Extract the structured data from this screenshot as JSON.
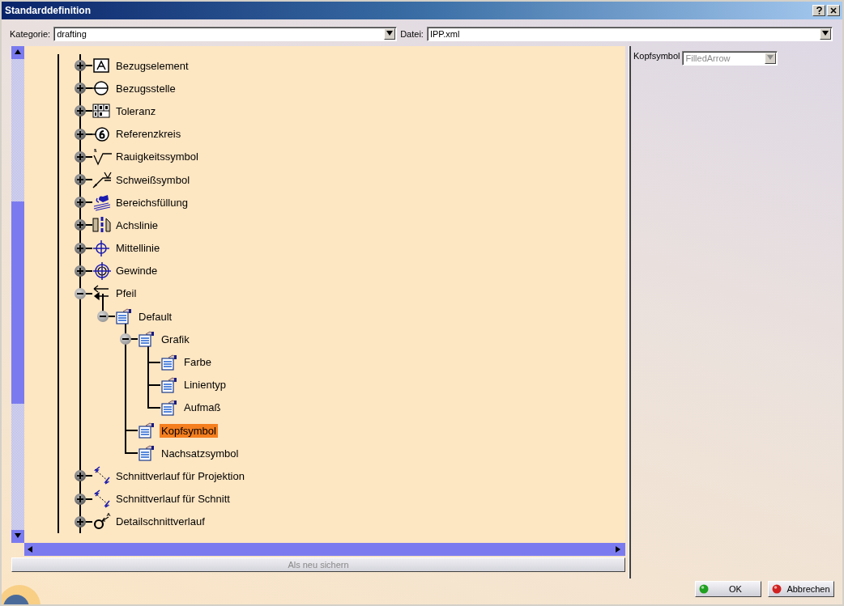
{
  "window": {
    "title": "Standarddefinition"
  },
  "toolbar": {
    "category": {
      "label": "Kategorie:",
      "value": "drafting"
    },
    "file": {
      "label": "Datei:",
      "value": "IPP.xml"
    }
  },
  "tree": {
    "items": [
      {
        "label": "Bezugselement",
        "kind": "datum",
        "expanded": false,
        "selected": false
      },
      {
        "label": "Bezugsstelle",
        "kind": "datum-target",
        "expanded": false,
        "selected": false
      },
      {
        "label": "Toleranz",
        "kind": "tolerance",
        "expanded": false,
        "selected": false
      },
      {
        "label": "Referenzkreis",
        "kind": "reference",
        "expanded": false,
        "selected": false
      },
      {
        "label": "Rauigkeitssymbol",
        "kind": "roughness",
        "expanded": false,
        "selected": false
      },
      {
        "label": "Schweißsymbol",
        "kind": "weld",
        "expanded": false,
        "selected": false
      },
      {
        "label": "Bereichsfüllung",
        "kind": "hatch",
        "expanded": false,
        "selected": false
      },
      {
        "label": "Achslinie",
        "kind": "axis",
        "expanded": false,
        "selected": false
      },
      {
        "label": "Mittellinie",
        "kind": "centerline",
        "expanded": false,
        "selected": false
      },
      {
        "label": "Gewinde",
        "kind": "thread",
        "expanded": false,
        "selected": false
      },
      {
        "label": "Pfeil",
        "kind": "arrow",
        "expanded": true,
        "selected": false,
        "children": [
          {
            "label": "Default",
            "kind": "settings",
            "expanded": true,
            "selected": false,
            "children": [
              {
                "label": "Grafik",
                "kind": "settings",
                "expanded": true,
                "selected": false,
                "children": [
                  {
                    "label": "Farbe",
                    "kind": "settings",
                    "selected": false
                  },
                  {
                    "label": "Linientyp",
                    "kind": "settings",
                    "selected": false
                  },
                  {
                    "label": "Aufmaß",
                    "kind": "settings",
                    "selected": false
                  }
                ]
              },
              {
                "label": "Kopfsymbol",
                "kind": "settings",
                "selected": true
              },
              {
                "label": "Nachsatzsymbol",
                "kind": "settings",
                "selected": false
              }
            ]
          }
        ]
      },
      {
        "label": "Schnittverlauf für Projektion",
        "kind": "section",
        "expanded": false,
        "selected": false
      },
      {
        "label": "Schnittverlauf für Schnitt",
        "kind": "section",
        "expanded": false,
        "selected": false
      },
      {
        "label": "Detailschnittverlauf",
        "kind": "detail",
        "expanded": false,
        "selected": false
      }
    ]
  },
  "save_button": {
    "label": "Als neu sichern",
    "disabled": true
  },
  "property": {
    "label": "Kopfsymbol",
    "value": "FilledArrow",
    "disabled": true
  },
  "buttons": [
    {
      "label": "OK",
      "kind": "ok"
    },
    {
      "label": "Abbrechen",
      "kind": "cancel"
    }
  ]
}
